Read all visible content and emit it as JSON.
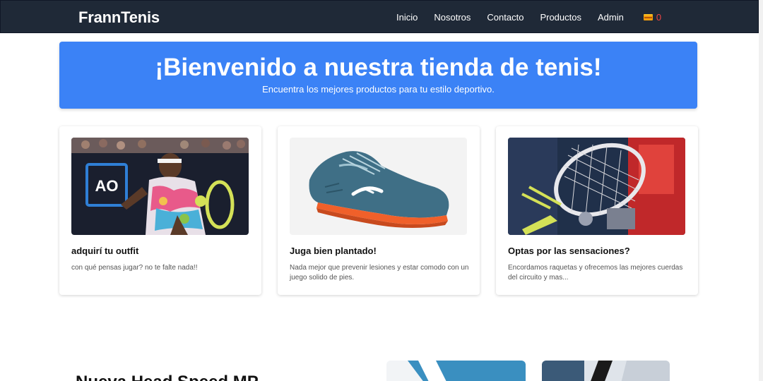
{
  "navbar": {
    "brand": "FrannTenis",
    "links": [
      "Inicio",
      "Nosotros",
      "Contacto",
      "Productos",
      "Admin"
    ],
    "cart_icon": "cart-icon",
    "cart_count": "0"
  },
  "hero": {
    "title": "¡Bienvenido a nuestra tienda de tenis!",
    "subtitle": "Encuentra los mejores productos para tu estilo deportivo.",
    "color": "#3b82f6"
  },
  "cards": [
    {
      "title": "adquirí tu outfit",
      "text": "con qué pensas jugar? no te falte nada!!",
      "image": "tennis-player-photo"
    },
    {
      "title": "Juga bien plantado!",
      "text": "Nada mejor que prevenir lesiones y estar comodo con un juego solido de pies.",
      "image": "tennis-shoe-photo"
    },
    {
      "title": "Optas por las sensaciones?",
      "text": "Encordamos raquetas y ofrecemos las mejores cuerdas del circuito y mas...",
      "image": "racket-stringing-photo"
    }
  ],
  "promo": {
    "title": "Nueva Head Speed MP"
  }
}
